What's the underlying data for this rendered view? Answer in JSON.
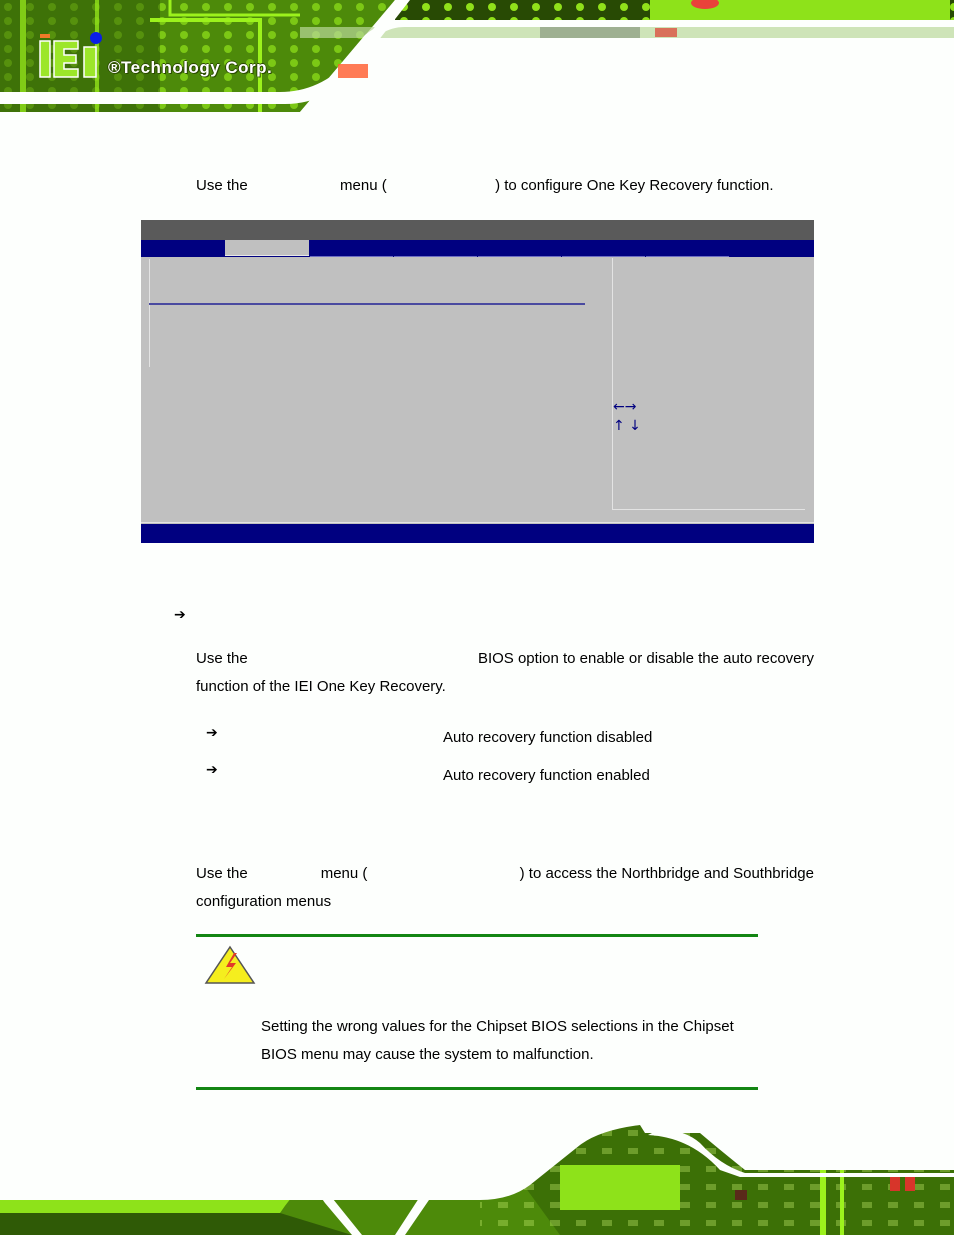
{
  "header": {
    "brand_logo": "iEi",
    "brand_text": "®Technology Corp."
  },
  "intro": {
    "prefix": "Use the",
    "middle": "menu (",
    "suffix": ") to configure One Key Recovery function."
  },
  "bios_screen": {
    "colors": {
      "title_bar": "#5a5a5a",
      "tab_bar": "#000080",
      "body": "#c0c0c0",
      "status_bar": "#000080",
      "key_hint": "#000080"
    },
    "tab_count": 7,
    "active_tab_index": 1,
    "key_hints": {
      "left_right": "←→",
      "up_down": "↑ ↓"
    }
  },
  "option_section": {
    "bullet": "➔",
    "desc_prefix": "Use the",
    "desc_middle": "BIOS option to enable or disable the auto recovery",
    "desc_line2": "function of the IEI One Key Recovery.",
    "options": [
      {
        "bullet": "➔",
        "description": "Auto recovery function disabled"
      },
      {
        "bullet": "➔",
        "description": "Auto recovery function enabled"
      }
    ]
  },
  "chipset_section": {
    "prefix": "Use the",
    "middle": "menu (",
    "suffix": ") to access the Northbridge and Southbridge",
    "line2": "configuration menus"
  },
  "warning": {
    "icon": "warning-triangle-lightning",
    "rule_color": "#138613",
    "line1": "Setting the wrong values for the Chipset BIOS selections in the Chipset",
    "line2": "BIOS menu may cause the system to malfunction."
  }
}
